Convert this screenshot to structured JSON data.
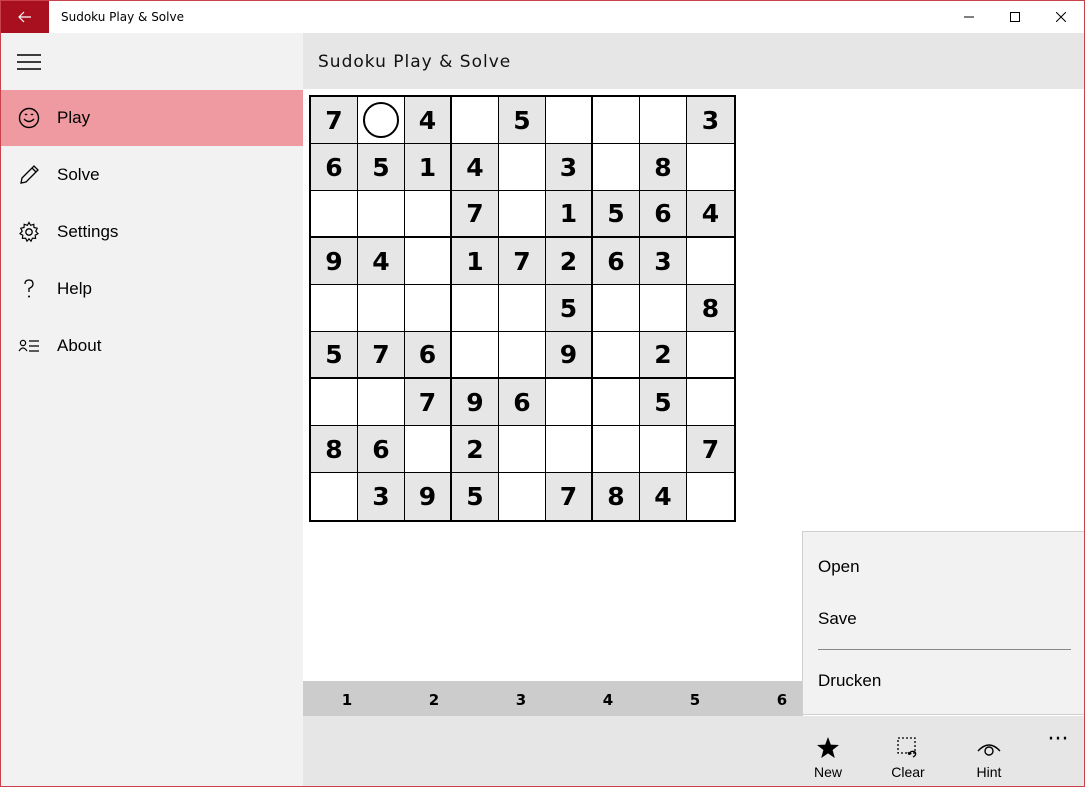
{
  "window": {
    "title": "Sudoku Play & Solve",
    "accent": "#a80f1f"
  },
  "sidebar": {
    "items": [
      {
        "label": "Play",
        "icon": "smiley-icon",
        "active": true
      },
      {
        "label": "Solve",
        "icon": "pencil-icon",
        "active": false
      },
      {
        "label": "Settings",
        "icon": "gear-icon",
        "active": false
      },
      {
        "label": "Help",
        "icon": "question-icon",
        "active": false
      },
      {
        "label": "About",
        "icon": "contact-list-icon",
        "active": false
      }
    ],
    "active_color": "#ef9aa0"
  },
  "header": {
    "title": "Sudoku Play & Solve"
  },
  "board": {
    "values": [
      [
        "7",
        "",
        "4",
        "",
        "5",
        "",
        "",
        "",
        "3"
      ],
      [
        "6",
        "5",
        "1",
        "4",
        "",
        "3",
        "",
        "8",
        ""
      ],
      [
        "",
        "",
        "",
        "7",
        "",
        "1",
        "5",
        "6",
        "4"
      ],
      [
        "9",
        "4",
        "",
        "1",
        "7",
        "2",
        "6",
        "3",
        ""
      ],
      [
        "",
        "",
        "",
        "",
        "",
        "5",
        "",
        "",
        "8"
      ],
      [
        "5",
        "7",
        "6",
        "",
        "",
        "9",
        "",
        "2",
        ""
      ],
      [
        "",
        "",
        "7",
        "9",
        "6",
        "",
        "",
        "5",
        ""
      ],
      [
        "8",
        "6",
        "",
        "2",
        "",
        "",
        "",
        "",
        "7"
      ],
      [
        "",
        "3",
        "9",
        "5",
        "",
        "7",
        "8",
        "4",
        ""
      ]
    ],
    "given": [
      [
        1,
        0,
        1,
        0,
        1,
        0,
        0,
        0,
        1
      ],
      [
        1,
        1,
        1,
        1,
        0,
        1,
        0,
        1,
        0
      ],
      [
        0,
        0,
        0,
        1,
        0,
        1,
        1,
        1,
        1
      ],
      [
        1,
        1,
        0,
        1,
        1,
        1,
        1,
        1,
        0
      ],
      [
        0,
        0,
        0,
        0,
        0,
        1,
        0,
        0,
        1
      ],
      [
        1,
        1,
        1,
        0,
        0,
        1,
        0,
        1,
        0
      ],
      [
        0,
        0,
        1,
        1,
        1,
        0,
        0,
        1,
        0
      ],
      [
        1,
        1,
        0,
        1,
        0,
        0,
        0,
        0,
        1
      ],
      [
        0,
        1,
        1,
        1,
        0,
        1,
        1,
        1,
        0
      ]
    ],
    "selected": [
      0,
      1
    ],
    "given_bg": "#e6e6e6"
  },
  "number_strip": [
    "1",
    "2",
    "3",
    "4",
    "5",
    "6"
  ],
  "commands": [
    {
      "label": "New",
      "icon": "star-icon"
    },
    {
      "label": "Clear",
      "icon": "clear-selection-icon"
    },
    {
      "label": "Hint",
      "icon": "eye-icon"
    }
  ],
  "more_label": "···",
  "overflow_menu": {
    "items": [
      "Open",
      "Save",
      "Drucken"
    ]
  }
}
